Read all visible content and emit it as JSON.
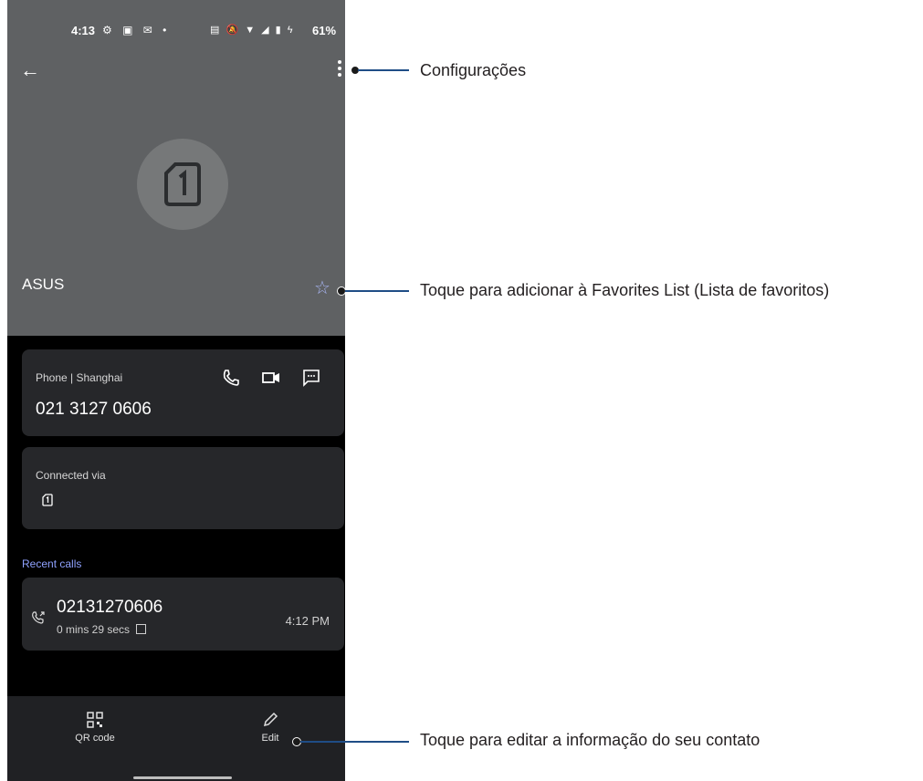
{
  "status_bar": {
    "time": "4:13",
    "battery": "61%"
  },
  "contact": {
    "name": "ASUS"
  },
  "phone_card": {
    "label": "Phone | Shanghai",
    "number": "021 3127 0606"
  },
  "connected_card": {
    "label": "Connected via"
  },
  "recent_calls": {
    "header": "Recent calls",
    "items": [
      {
        "number": "02131270606",
        "duration": "0 mins 29 secs",
        "time": "4:12 PM"
      }
    ]
  },
  "bottom_bar": {
    "qr_label": "QR code",
    "edit_label": "Edit"
  },
  "annotations": {
    "settings": "Configurações",
    "favorites": "Toque para adicionar à Favorites List (Lista de favoritos)",
    "edit": "Toque para editar a informação do seu contato"
  },
  "colors": {
    "header_bg": "#5f6163",
    "card_bg": "#26272a",
    "accent": "#8fa2ff",
    "callout_line": "#1f4d86"
  }
}
